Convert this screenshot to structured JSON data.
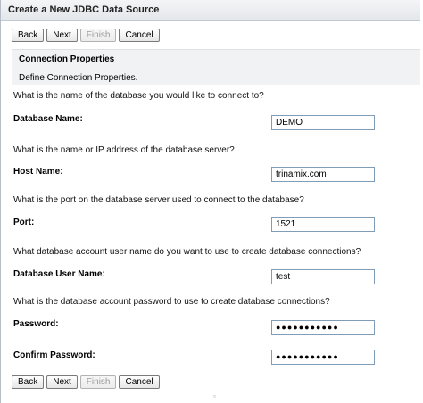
{
  "window": {
    "title": "Create a New JDBC Data Source"
  },
  "buttons": {
    "back": "Back",
    "next": "Next",
    "finish": "Finish",
    "cancel": "Cancel"
  },
  "section": {
    "heading": "Connection Properties",
    "description": "Define Connection Properties."
  },
  "fields": {
    "database_name": {
      "question": "What is the name of the database you would like to connect to?",
      "label": "Database Name:",
      "value": "DEMO"
    },
    "host_name": {
      "question": "What is the name or IP address of the database server?",
      "label": "Host Name:",
      "value": "trinamix.com"
    },
    "port": {
      "question": "What is the port on the database server used to connect to the database?",
      "label": "Port:",
      "value": "1521"
    },
    "user_name": {
      "question": "What database account user name do you want to use to create database connections?",
      "label": "Database User Name:",
      "value": "test"
    },
    "password": {
      "question": "What is the database account password to use to create database connections?",
      "label": "Password:",
      "value": "●●●●●●●●●●●"
    },
    "confirm_password": {
      "label": "Confirm Password:",
      "value": "●●●●●●●●●●●"
    }
  },
  "footer": {
    "marker": "▫"
  }
}
